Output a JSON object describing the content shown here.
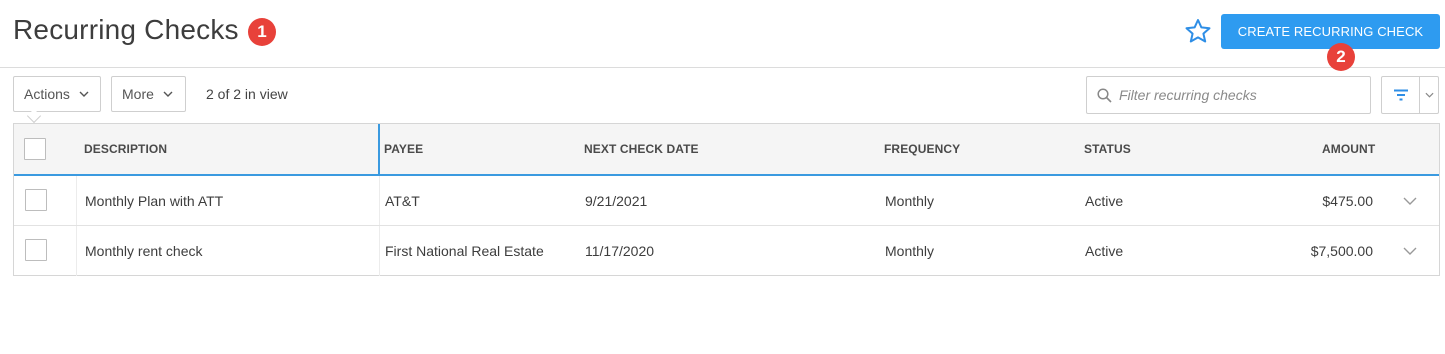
{
  "header": {
    "title": "Recurring Checks",
    "badge_1": "1",
    "badge_2": "2",
    "create_button_label": "CREATE RECURRING CHECK"
  },
  "toolbar": {
    "actions_label": "Actions",
    "more_label": "More",
    "view_count": "2 of 2 in view",
    "filter_placeholder": "Filter recurring checks"
  },
  "table": {
    "columns": [
      "DESCRIPTION",
      "PAYEE",
      "NEXT CHECK DATE",
      "FREQUENCY",
      "STATUS",
      "AMOUNT"
    ],
    "rows": [
      {
        "description": "Monthly Plan with ATT",
        "payee": "AT&T",
        "next_check_date": "9/21/2021",
        "frequency": "Monthly",
        "status": "Active",
        "amount": "$475.00"
      },
      {
        "description": "Monthly rent check",
        "payee": "First National Real Estate",
        "next_check_date": "11/17/2020",
        "frequency": "Monthly",
        "status": "Active",
        "amount": "$7,500.00"
      }
    ]
  },
  "colors": {
    "accent": "#2e9bf0",
    "badge": "#e8413a",
    "star": "#2e8ee6"
  },
  "icons": {
    "star": "star-icon",
    "search": "search-icon",
    "filter": "filter-icon",
    "chevron": "chevron-down-icon"
  }
}
